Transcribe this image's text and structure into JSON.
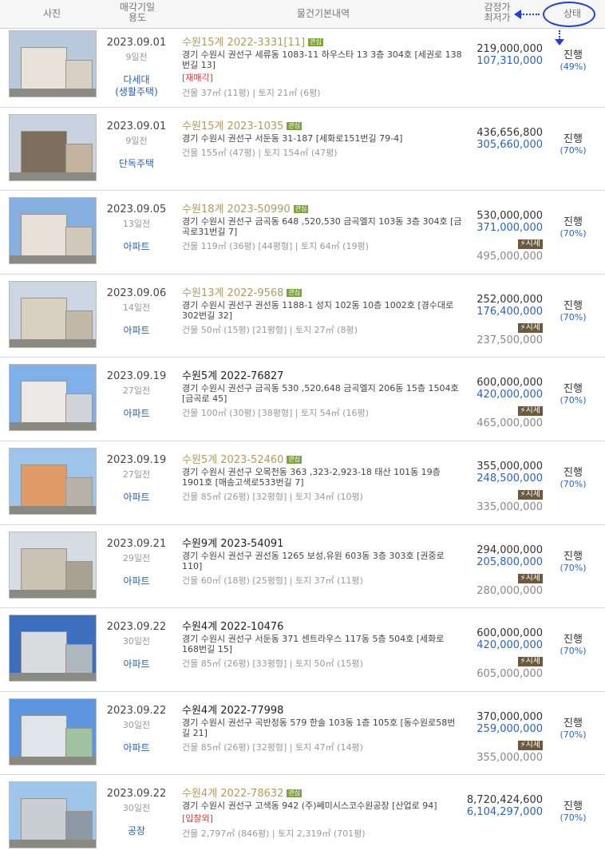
{
  "header": {
    "photo": "사진",
    "date_line1": "매각기일",
    "date_line2": "용도",
    "info": "물건기본내역",
    "price_line1": "감정가",
    "price_line2": "최저가",
    "status": "상태"
  },
  "labels": {
    "interest_badge": "관심",
    "market_badge": "⚡시세"
  },
  "colors": {
    "annotation": "#1f3fd8",
    "case_gold": "#b29a61",
    "min_price_blue": "#2a62c8",
    "use_blue": "#2a5fb0"
  },
  "rows": [
    {
      "date": "2023.09.01",
      "days_ago": "9일전",
      "use_line1": "다세대",
      "use_line2": "(생활주택)",
      "case": "수원15계 2022-3331[11]",
      "case_style": "gold",
      "interest": true,
      "addr": "경기 수원시 권선구 세류동 1083-11 하우스타 13 3층 304호 [세권로 138번길 13]",
      "note": "[재매각]",
      "area": "건물 37㎡ (11평)  |  토지 21㎡ (6평)",
      "appraisal": "219,000,000",
      "min_price": "107,310,000",
      "market": false,
      "market_price": "",
      "status": "진행",
      "pct": "(49%)"
    },
    {
      "date": "2023.09.01",
      "days_ago": "9일전",
      "use_line1": "단독주택",
      "use_line2": "",
      "case": "수원15계 2023-1035",
      "case_style": "gold",
      "interest": true,
      "addr": "경기 수원시 권선구 서둔동 31-187 [세화로151번길 79-4]",
      "note": "",
      "area": "건물 155㎡ (47평)  |  토지 154㎡ (47평)",
      "appraisal": "436,656,800",
      "min_price": "305,660,000",
      "market": false,
      "market_price": "",
      "status": "진행",
      "pct": "(70%)"
    },
    {
      "date": "2023.09.05",
      "days_ago": "13일전",
      "use_line1": "아파트",
      "use_line2": "",
      "case": "수원18계 2023-50990",
      "case_style": "gold",
      "interest": true,
      "addr": "경기 수원시 권선구 금곡동 648 ,520,530 금곡엘지 103동 3층 304호 [금곡로31번길 7]",
      "note": "",
      "area": "건물 119㎡ (36평) [44평형]  |  토지 64㎡ (19평)",
      "appraisal": "530,000,000",
      "min_price": "371,000,000",
      "market": true,
      "market_price": "495,000,000",
      "status": "진행",
      "pct": "(70%)"
    },
    {
      "date": "2023.09.06",
      "days_ago": "14일전",
      "use_line1": "아파트",
      "use_line2": "",
      "case": "수원13계 2022-9568",
      "case_style": "gold",
      "interest": true,
      "addr": "경기 수원시 권선구 권선동 1188-1 성지 102동 10층 1002호 [경수대로 302번길 32]",
      "note": "",
      "area": "건물 50㎡ (15평) [21평형]  |  토지 27㎡ (8평)",
      "appraisal": "252,000,000",
      "min_price": "176,400,000",
      "market": true,
      "market_price": "237,500,000",
      "status": "진행",
      "pct": "(70%)"
    },
    {
      "date": "2023.09.19",
      "days_ago": "27일전",
      "use_line1": "아파트",
      "use_line2": "",
      "case": "수원5계 2022-76827",
      "case_style": "black",
      "interest": false,
      "addr": "경기 수원시 권선구 금곡동 530 ,520,648 금곡엘지 206동 15층 1504호 [금곡로 45]",
      "note": "",
      "area": "건물 100㎡ (30평) [38평형]  |  토지 54㎡ (16평)",
      "appraisal": "600,000,000",
      "min_price": "420,000,000",
      "market": true,
      "market_price": "465,000,000",
      "status": "진행",
      "pct": "(70%)"
    },
    {
      "date": "2023.09.19",
      "days_ago": "27일전",
      "use_line1": "아파트",
      "use_line2": "",
      "case": "수원5계 2023-52460",
      "case_style": "gold",
      "interest": true,
      "addr": "경기 수원시 권선구 오목천동 363 ,323-2,923-18 태산 101동 19층 1901호 [매송고색로533번길 7]",
      "note": "",
      "area": "건물 85㎡ (26평) [32평형]  |  토지 34㎡ (10평)",
      "appraisal": "355,000,000",
      "min_price": "248,500,000",
      "market": true,
      "market_price": "335,000,000",
      "status": "진행",
      "pct": "(70%)"
    },
    {
      "date": "2023.09.21",
      "days_ago": "29일전",
      "use_line1": "아파트",
      "use_line2": "",
      "case": "수원9계 2023-54091",
      "case_style": "black",
      "interest": false,
      "addr": "경기 수원시 권선구 권선동 1265 보성,유원 603동 3층 303호 [권중로 110]",
      "note": "",
      "area": "건물 60㎡ (18평) [25평형]  |  토지 37㎡ (11평)",
      "appraisal": "294,000,000",
      "min_price": "205,800,000",
      "market": true,
      "market_price": "280,000,000",
      "status": "진행",
      "pct": "(70%)"
    },
    {
      "date": "2023.09.22",
      "days_ago": "30일전",
      "use_line1": "아파트",
      "use_line2": "",
      "case": "수원4계 2022-10476",
      "case_style": "black",
      "interest": false,
      "addr": "경기 수원시 권선구 서둔동 371 센트라우스 117동 5층 504호 [세화로 168번길 15]",
      "note": "",
      "area": "건물 85㎡ (26평) [33평형]  |  토지 50㎡ (15평)",
      "appraisal": "600,000,000",
      "min_price": "420,000,000",
      "market": true,
      "market_price": "605,000,000",
      "status": "진행",
      "pct": "(70%)"
    },
    {
      "date": "2023.09.22",
      "days_ago": "30일전",
      "use_line1": "아파트",
      "use_line2": "",
      "case": "수원4계 2022-77998",
      "case_style": "black",
      "interest": false,
      "addr": "경기 수원시 권선구 곡반정동 579 한솔 103동 1층 105호 [동수원로58번길 21]",
      "note": "",
      "area": "건물 85㎡ (26평) [32평형]  |  토지 47㎡ (14평)",
      "appraisal": "370,000,000",
      "min_price": "259,000,000",
      "market": true,
      "market_price": "355,000,000",
      "status": "진행",
      "pct": "(70%)"
    },
    {
      "date": "2023.09.22",
      "days_ago": "30일전",
      "use_line1": "공장",
      "use_line2": "",
      "case": "수원4계 2022-78632",
      "case_style": "gold",
      "interest": true,
      "addr": "경기 수원시 권선구 고색동 942 (주)쎄미시스코수원공장 [산업로 94]",
      "note": "[입찰외]",
      "area": "건물 2,797㎡ (846평)  |  토지 2,319㎡ (701평)",
      "appraisal": "8,720,424,600",
      "min_price": "6,104,297,000",
      "market": false,
      "market_price": "",
      "status": "진행",
      "pct": "(70%)"
    }
  ]
}
